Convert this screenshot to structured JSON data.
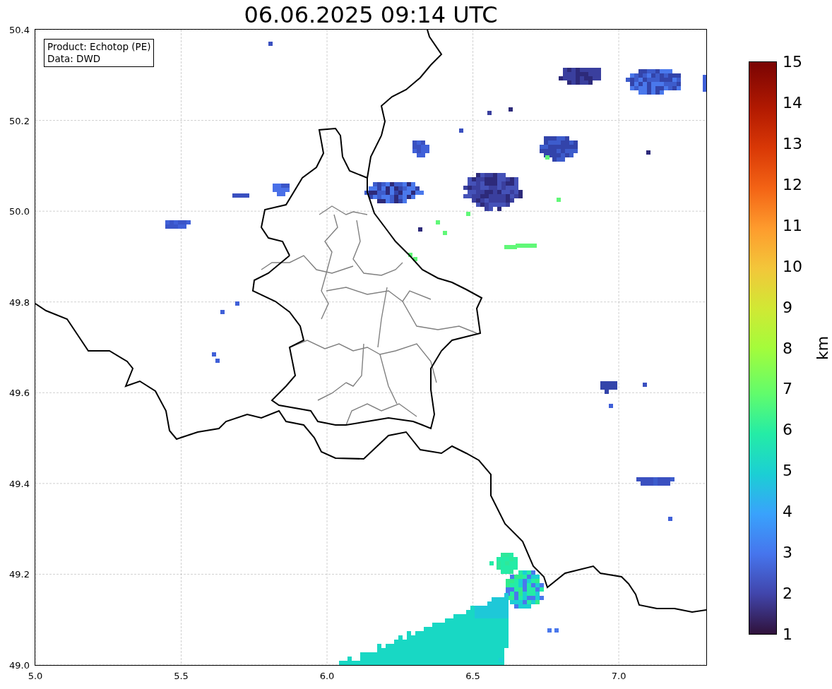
{
  "title": "06.06.2025 09:14 UTC",
  "legend": [
    "Product: Echotop (PE)",
    "Data: DWD"
  ],
  "map": {
    "x_ticks": [
      "5.0",
      "5.5",
      "6.0",
      "6.5",
      "7.0"
    ],
    "y_ticks": [
      "50.4",
      "50.2",
      "50.0",
      "49.8",
      "49.6",
      "49.4",
      "49.2",
      "49.0"
    ]
  },
  "colorbar": {
    "label": "km",
    "ticks": [
      "15",
      "14",
      "13",
      "12",
      "11",
      "10",
      "9",
      "8",
      "7",
      "6",
      "5",
      "4",
      "3",
      "2",
      "1"
    ]
  }
}
